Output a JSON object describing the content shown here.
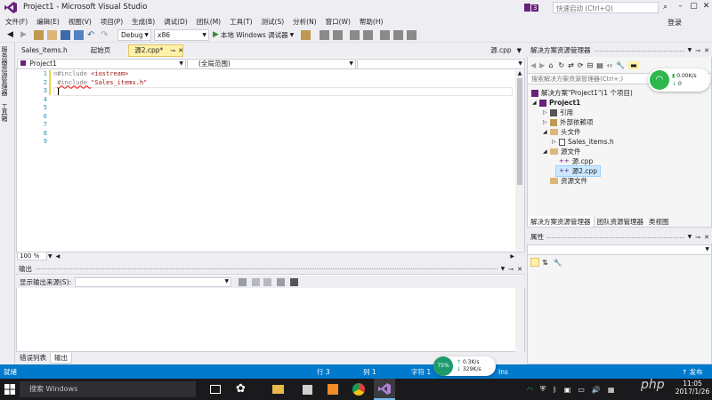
{
  "window": {
    "title": "Project1 - Microsoft Visual Studio",
    "notification_count": "3",
    "quick_launch_placeholder": "快速启动 (Ctrl+Q)",
    "login": "登录"
  },
  "menu": [
    "文件(F)",
    "编辑(E)",
    "视图(V)",
    "项目(P)",
    "生成(B)",
    "调试(D)",
    "团队(M)",
    "工具(T)",
    "测试(S)",
    "分析(N)",
    "窗口(W)",
    "帮助(H)"
  ],
  "toolbar": {
    "config": "Debug",
    "platform": "x86",
    "run_label": "本地 Windows 调试器"
  },
  "left_strip": [
    "服务器资源管理器",
    "工具箱"
  ],
  "editor": {
    "tabs": [
      {
        "label": "Sales_items.h",
        "active": false
      },
      {
        "label": "起始页",
        "active": false
      },
      {
        "label": "源2.cpp*",
        "active": true
      },
      {
        "label": "源.cpp",
        "active": false
      }
    ],
    "nav_project": "Project1",
    "nav_scope": "(全局范围)",
    "nav_member": "",
    "line_numbers": [
      "1",
      "2",
      "3",
      "4",
      "5",
      "6",
      "7",
      "8",
      "9"
    ],
    "code": [
      {
        "prefix": "#include ",
        "arg": "<iostream>"
      },
      {
        "prefix": "#include ",
        "arg": "\"Sales_items.h\""
      }
    ],
    "zoom": "100 %"
  },
  "output": {
    "title": "输出",
    "source_label": "显示输出来源(S):",
    "source_value": ""
  },
  "bottom_tabs": [
    {
      "label": "错误列表",
      "active": false
    },
    {
      "label": "输出",
      "active": true
    }
  ],
  "solution_explorer": {
    "title": "解决方案资源管理器",
    "search_placeholder": "搜索解决方案资源管理器(Ctrl+;)",
    "tree": [
      {
        "label": "解决方案\"Project1\"(1 个项目)",
        "level": 0,
        "icon": "solution-icon"
      },
      {
        "label": "Project1",
        "level": 1,
        "icon": "project-icon",
        "bold": true
      },
      {
        "label": "引用",
        "level": 2,
        "icon": "references-icon"
      },
      {
        "label": "外部依赖项",
        "level": 2,
        "icon": "external-deps-icon"
      },
      {
        "label": "头文件",
        "level": 2,
        "icon": "folder-icon"
      },
      {
        "label": "Sales_items.h",
        "level": 3,
        "icon": "header-file-icon"
      },
      {
        "label": "源文件",
        "level": 2,
        "icon": "folder-icon"
      },
      {
        "label": "源.cpp",
        "level": 3,
        "icon": "cpp-file-icon"
      },
      {
        "label": "源2.cpp",
        "level": 3,
        "icon": "cpp-file-icon",
        "selected": true
      },
      {
        "label": "资源文件",
        "level": 2,
        "icon": "folder-icon"
      }
    ],
    "tabs": [
      {
        "label": "解决方案资源管理器",
        "active": true
      },
      {
        "label": "团队资源管理器",
        "active": false
      },
      {
        "label": "类视图",
        "active": false
      }
    ]
  },
  "properties": {
    "title": "属性"
  },
  "wifi_widget": {
    "upload": "0.00K/s",
    "download": "0"
  },
  "status": {
    "ready": "就绪",
    "line": "行 3",
    "col": "列 1",
    "char": "字符 1",
    "ins": "Ins",
    "publish": "↑ 发布"
  },
  "net_widget": {
    "percent": "75%",
    "up": "0.3K/s",
    "down": "329K/s"
  },
  "taskbar": {
    "search_placeholder": "搜索 Windows",
    "time": "11:05",
    "date": "2017/1/26",
    "watermark": "php"
  },
  "colors": {
    "accent": "#007acc",
    "vs_purple": "#68217a",
    "active_tab": "#fff1a8",
    "taskbar": "#1a1a1d"
  }
}
